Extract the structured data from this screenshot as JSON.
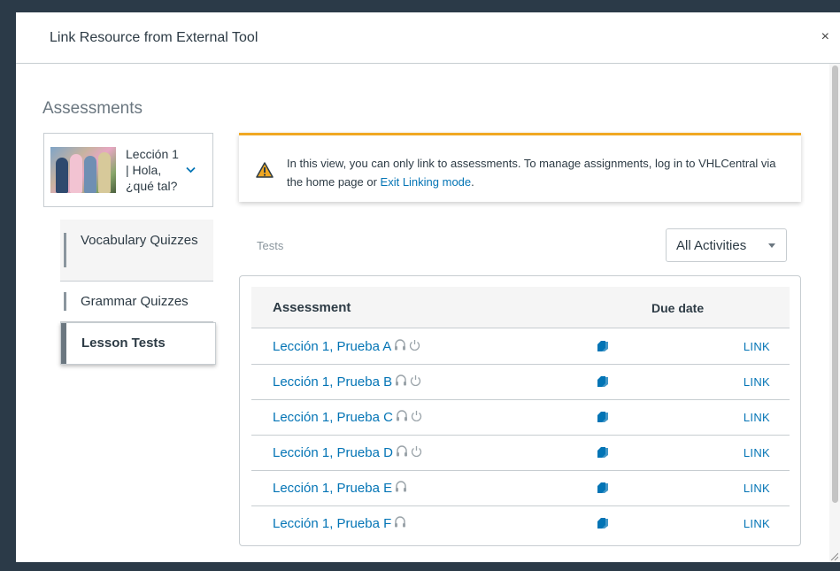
{
  "modal": {
    "title": "Link Resource from External Tool",
    "close_label": "×"
  },
  "sidebar": {
    "heading": "Assessments",
    "lesson": {
      "label": "Lección 1 | Hola, ¿qué tal?",
      "chevron_icon": "chevron-down-icon"
    },
    "nav_items": [
      {
        "label": "Vocabulary Quizzes",
        "active": false
      },
      {
        "label": "Grammar Quizzes",
        "active": false
      },
      {
        "label": "Lesson Tests",
        "active": true
      }
    ]
  },
  "alert": {
    "icon": "warning-icon",
    "text_before": "In this view, you can only link to assessments. To manage assignments, log in to VHLCentral via the home page or ",
    "link_text": "Exit Linking mode",
    "text_after": "."
  },
  "tests": {
    "label": "Tests",
    "filter_value": "All Activities",
    "columns": {
      "assessment": "Assessment",
      "due_date": "Due date"
    },
    "link_label": "LINK",
    "rows": [
      {
        "name": "Lección 1, Prueba A",
        "icons": [
          "headphones-icon",
          "power-icon"
        ]
      },
      {
        "name": "Lección 1, Prueba B",
        "icons": [
          "headphones-icon",
          "power-icon"
        ]
      },
      {
        "name": "Lección 1, Prueba C",
        "icons": [
          "headphones-icon",
          "power-icon"
        ]
      },
      {
        "name": "Lección 1, Prueba D",
        "icons": [
          "headphones-icon",
          "power-icon"
        ]
      },
      {
        "name": "Lección 1, Prueba E",
        "icons": [
          "headphones-icon"
        ]
      },
      {
        "name": "Lección 1, Prueba F",
        "icons": [
          "headphones-icon"
        ]
      }
    ]
  },
  "colors": {
    "link": "#0374b5",
    "warning": "#f0a823",
    "text": "#2d3b45",
    "muted": "#8b969e"
  }
}
